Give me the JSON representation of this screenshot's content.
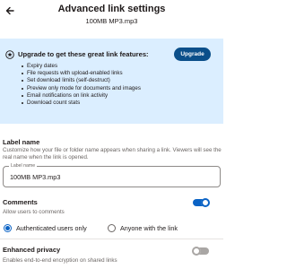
{
  "header": {
    "title": "Advanced link settings",
    "subtitle": "100MB MP3.mp3",
    "back_icon": "arrow-left-icon"
  },
  "upsell": {
    "icon": "star-icon",
    "heading": "Upgrade to get these great link features:",
    "upgrade_label": "Upgrade",
    "features": [
      "Expiry dates",
      "File requests with upload-enabled links",
      "Set download limits (self-destruct)",
      "Preview only mode for documents and images",
      "Email notifications on link activity",
      "Download count stats"
    ]
  },
  "label_name": {
    "title": "Label name",
    "description": "Customize how your file or folder name appears when sharing a link. Viewers will see the real name when the link is opened.",
    "field_label": "Label name",
    "field_value": "100MB MP3.mp3"
  },
  "comments": {
    "title": "Comments",
    "description": "Allow users to comments",
    "enabled": true,
    "options": [
      {
        "label": "Authenticated users only",
        "checked": true
      },
      {
        "label": "Anyone with the link",
        "checked": false
      }
    ]
  },
  "privacy": {
    "title": "Enhanced privacy",
    "description": "Enables end-to-end encryption on shared links",
    "enabled": false
  },
  "colors": {
    "accent": "#0b63c5",
    "upgrade_button": "#0b4f8a",
    "upsell_bg": "#dbeeff"
  }
}
